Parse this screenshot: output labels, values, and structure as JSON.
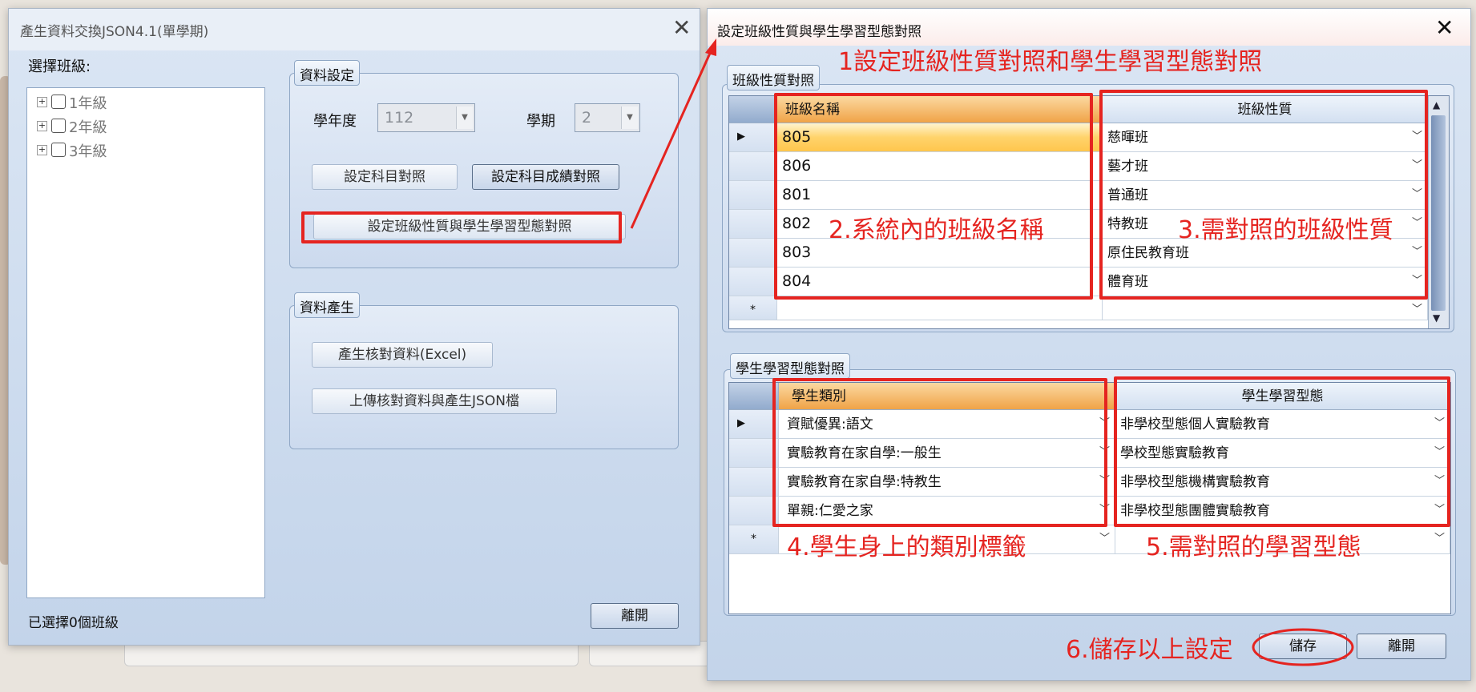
{
  "left_dialog": {
    "title": "產生資料交換JSON4.1(單學期)",
    "select_class_label": "選擇班級:",
    "tree_items": [
      {
        "label": "1年級"
      },
      {
        "label": "2年級"
      },
      {
        "label": "3年級"
      }
    ],
    "data_settings": {
      "legend": "資料設定",
      "school_year_label": "學年度",
      "school_year_value": "112",
      "semester_label": "學期",
      "semester_value": "2",
      "subject_mapping_button": "設定科目對照",
      "subject_score_mapping_button": "設定科目成績對照",
      "class_type_mapping_button": "設定班級性質與學生學習型態對照"
    },
    "data_generation": {
      "legend": "資料產生",
      "generate_excel_button": "產生核對資料(Excel)",
      "upload_json_button": "上傳核對資料與產生JSON檔"
    },
    "status": "已選擇0個班級",
    "leave_button": "離開"
  },
  "right_dialog": {
    "title": "設定班級性質與學生學習型態對照",
    "class_group": {
      "legend": "班級性質對照",
      "columns": [
        "班級名稱",
        "班級性質"
      ],
      "rows": [
        {
          "name": "805",
          "type": "慈暉班"
        },
        {
          "name": "806",
          "type": "藝才班"
        },
        {
          "name": "801",
          "type": "普通班"
        },
        {
          "name": "802",
          "type": "特教班"
        },
        {
          "name": "803",
          "type": "原住民教育班"
        },
        {
          "name": "804",
          "type": "體育班"
        }
      ],
      "new_row_marker": "*"
    },
    "student_group": {
      "legend": "學生學習型態對照",
      "columns": [
        "學生類別",
        "學生學習型態"
      ],
      "rows": [
        {
          "category": "資賦優異:語文",
          "mode": "非學校型態個人實驗教育"
        },
        {
          "category": "實驗教育在家自學:一般生",
          "mode": "學校型態實驗教育"
        },
        {
          "category": "實驗教育在家自學:特教生",
          "mode": "非學校型態機構實驗教育"
        },
        {
          "category": "單親:仁愛之家",
          "mode": "非學校型態團體實驗教育"
        }
      ],
      "new_row_marker": "*"
    },
    "save_button": "儲存",
    "leave_button": "離開"
  },
  "annotations": {
    "step1": "1設定班級性質對照和學生學習型態對照",
    "step2": "2.系統內的班級名稱",
    "step3": "3.需對照的班級性質",
    "step4": "4.學生身上的類別標籤",
    "step5": "5.需對照的學習型態",
    "step6": "6.儲存以上設定"
  },
  "colors": {
    "annotation_red": "#e52420",
    "selected_row": "#ffc64d",
    "header_orange": "#f0a347"
  }
}
